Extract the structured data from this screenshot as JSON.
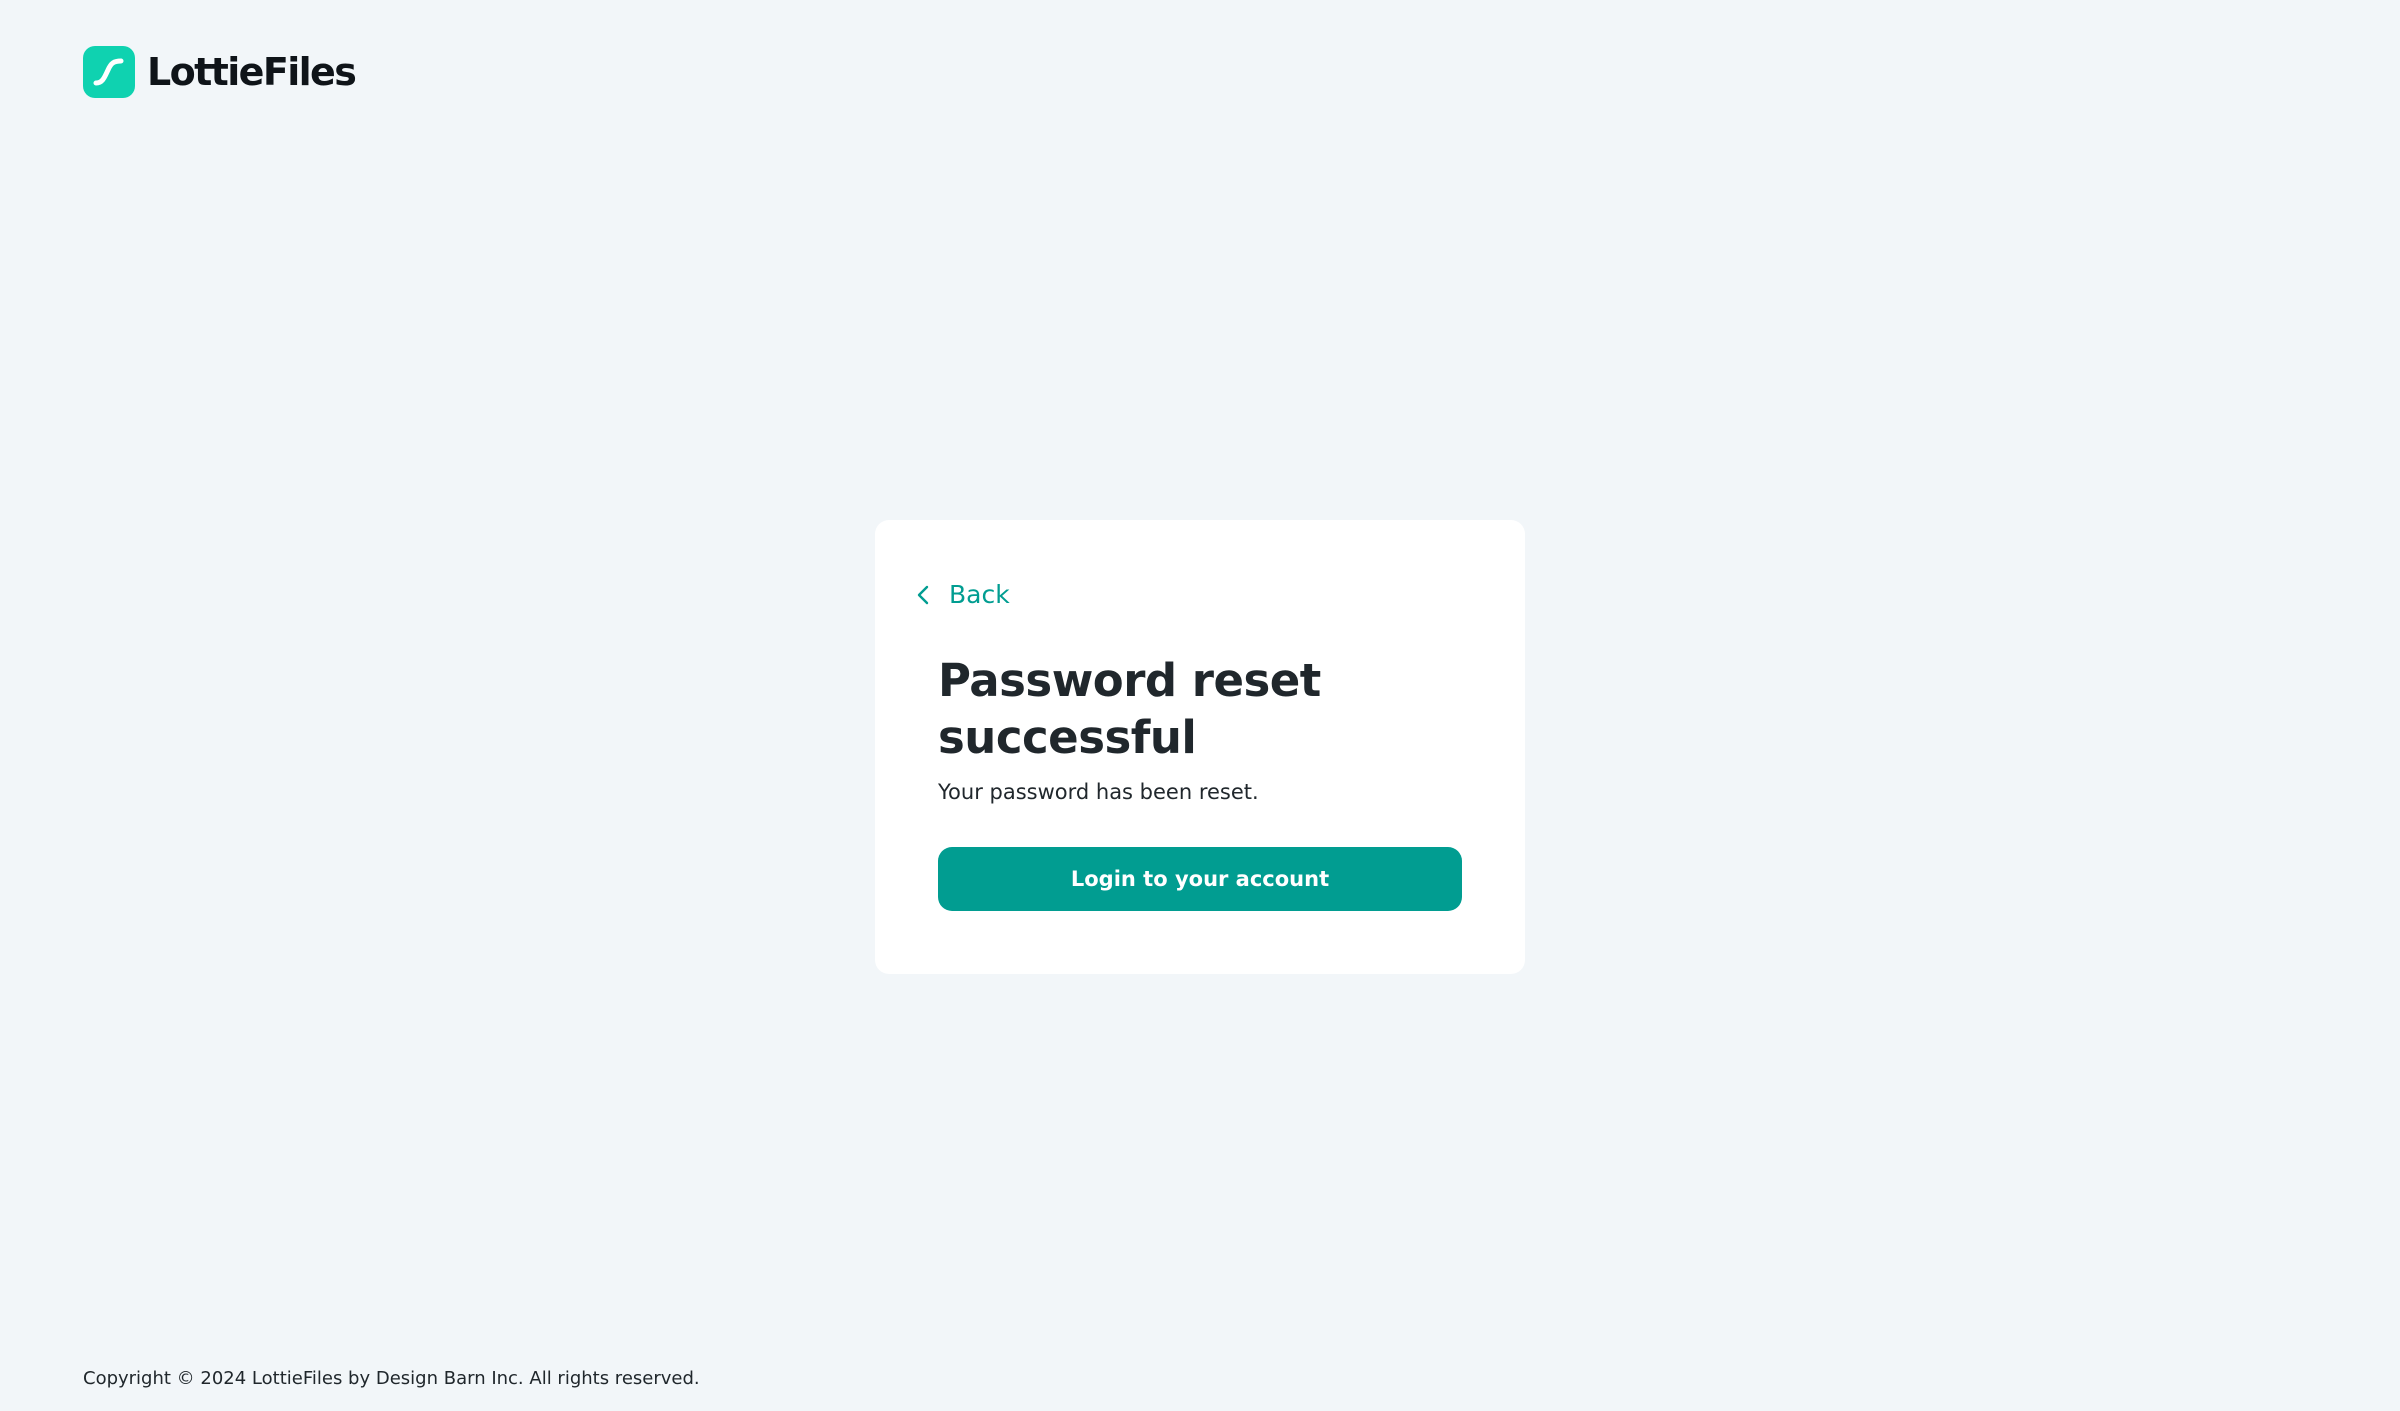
{
  "header": {
    "logo_text": "LottieFiles",
    "logo_icon": "lottiefiles-logo-icon"
  },
  "card": {
    "back_label": "Back",
    "back_icon": "chevron-left-icon",
    "title": "Password reset successful",
    "subtitle": "Your password has been reset.",
    "login_button_label": "Login to your account"
  },
  "footer": {
    "copyright": "Copyright © 2024 LottieFiles by Design Barn Inc. All rights reserved."
  },
  "colors": {
    "background": "#f2f6f9",
    "accent": "#019d91",
    "logo_mark": "#0fd2b0",
    "text": "#20272c"
  }
}
